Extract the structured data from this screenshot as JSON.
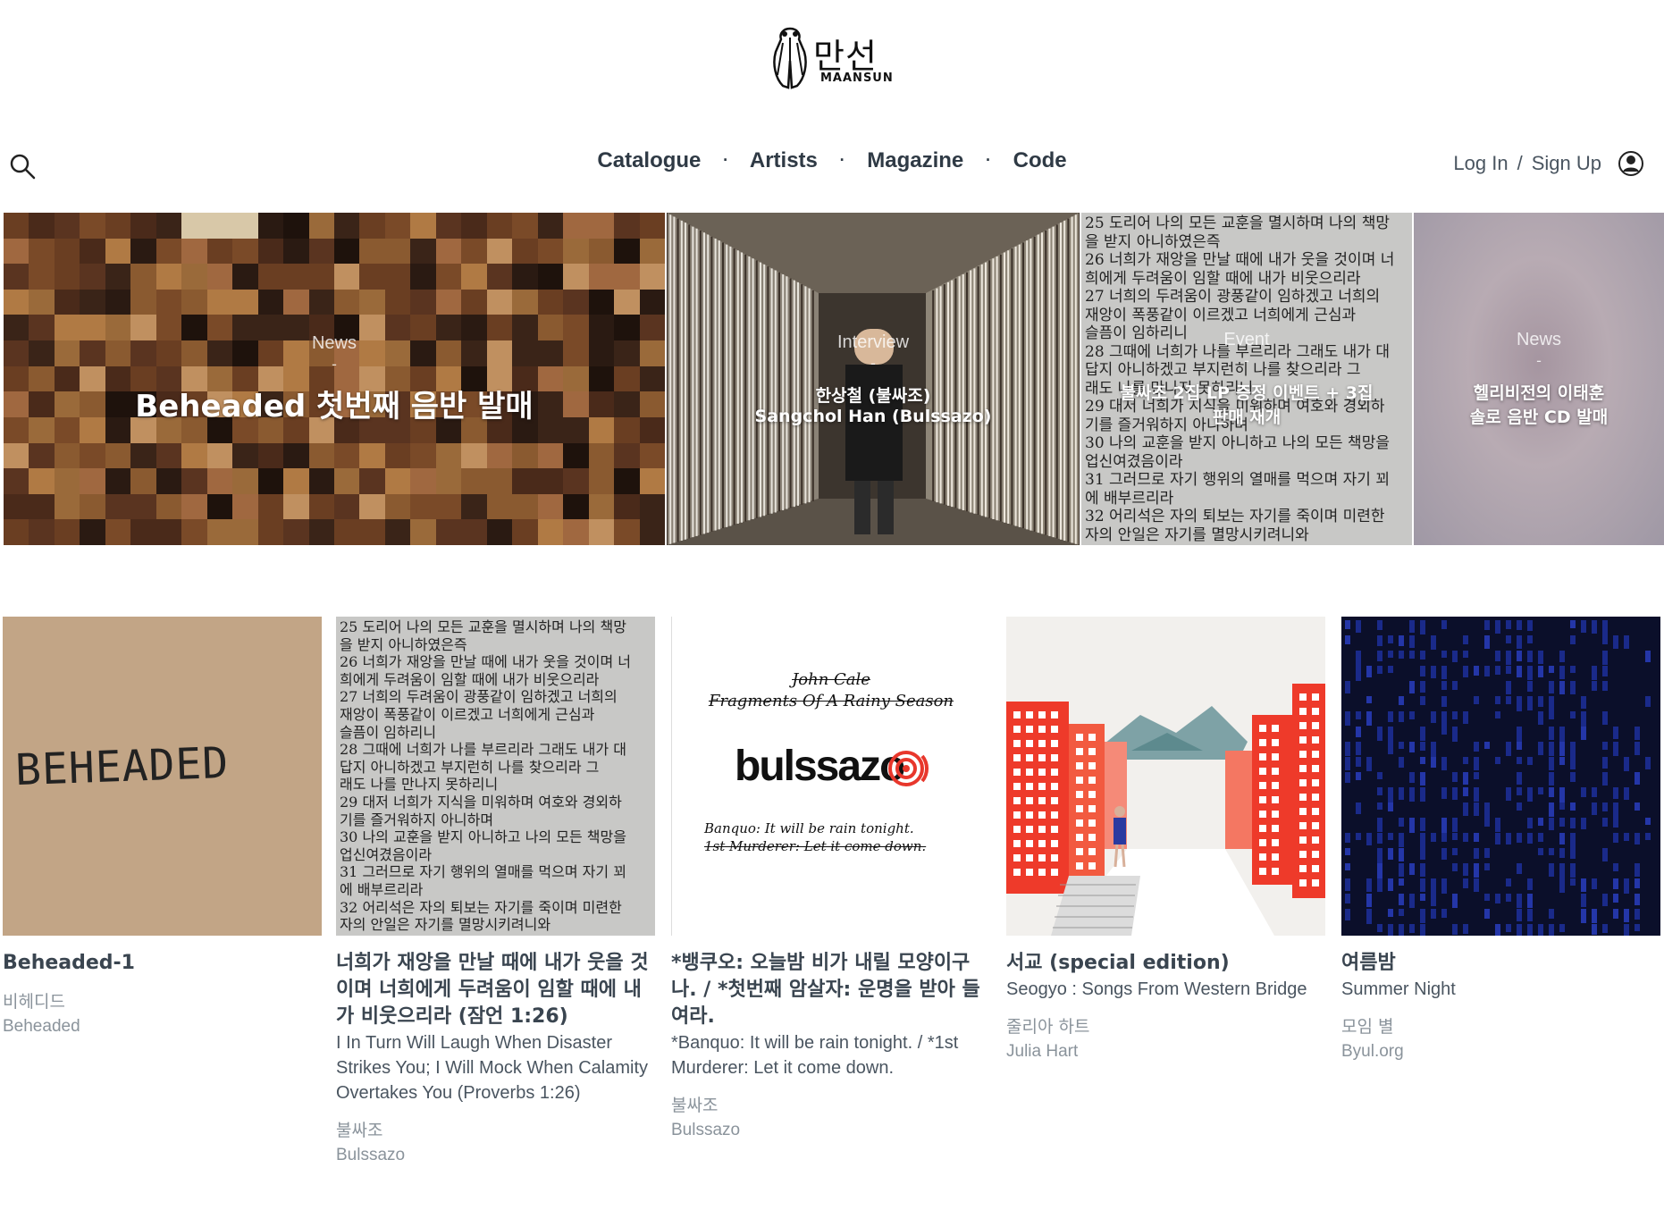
{
  "header": {
    "logo_text": "만선",
    "logo_sub": "MAANSUN"
  },
  "nav": {
    "items": [
      "Catalogue",
      "Artists",
      "Magazine",
      "Code"
    ],
    "separator": "·"
  },
  "auth": {
    "login": "Log In",
    "separator": "/",
    "signup": "Sign Up"
  },
  "hero": [
    {
      "category": "News",
      "dash": "-",
      "title": "Beheaded 첫번째 음반 발매"
    },
    {
      "category": "Interview",
      "dash": "-",
      "title_line1": "한상철 (불싸조)",
      "title_line2": "Sangchol Han (Bulssazo)"
    },
    {
      "category": "Event",
      "dash": "-",
      "title_line1": "불싸조 2집 LP 증정 이벤트 + 3집",
      "title_line2": "판매 재개"
    },
    {
      "category": "News",
      "dash": "-",
      "title_line1": "헬리비전의 이태훈",
      "title_line2": "솔로 음반 CD 발매"
    }
  ],
  "hero3_text": [
    "25 도리어 나의 모든 교훈을 멸시하며 나의 책망",
    "을 받지 아니하였은즉",
    "26 너희가 재앙을 만날 때에 내가 웃을 것이며 너",
    "희에게 두려움이 임할 때에 내가 비웃으리라",
    "27 너희의 두려움이 광풍같이 임하겠고 너희의",
    "재앙이 폭풍같이 이르겠고 너희에게 근심과",
    "슬픔이 임하리니",
    "28 그때에 너희가 나를 부르리라 그래도 내가 대",
    "답지 아니하겠고 부지런히 나를 찾으리라 그",
    "래도 나를 만나지 못하리니",
    "29 대저 너희가 지식을 미워하며 여호와 경외하",
    "기를 즐거워하지 아니하며",
    "30 나의 교훈을 받지 아니하고 나의 모든 책망을",
    "업신여겼음이라",
    "31 그러므로 자기 행위의 열매를 먹으며 자기 꾀",
    "에 배부르리라",
    "32 어리석은 자의 퇴보는 자기를 죽이며 미련한",
    "자의 안일은 자기를 멸망시키려니와"
  ],
  "cards": [
    {
      "cover_text": "BEHEADED",
      "title": "Beheaded-1",
      "subtitle": "",
      "artist_ko": "비헤디드",
      "artist_en": "Beheaded"
    },
    {
      "title": "너희가 재앙을 만날 때에 내가 웃을 것이며 너희에게 두려움이 임할 때에 내가 비웃으리라 (잠언 1:26)",
      "subtitle": "I In Turn Will Laugh When Disaster Strikes You; I Will Mock When Calamity Overtakes You (Proverbs 1:26)",
      "artist_ko": "불싸조",
      "artist_en": "Bulssazo"
    },
    {
      "cover_line1": "John Cale",
      "cover_line2": "Fragments Of A Rainy Season",
      "cover_brand": "bulssazo",
      "cover_quote1": "Banquo: It will be rain tonight.",
      "cover_quote2": "1st Murderer: Let it come down.",
      "title": "*뱅쿠오: 오늘밤 비가 내릴 모양이구나. / *첫번째 암살자: 운명을 받아 들여라.",
      "subtitle": "*Banquo: It will be rain tonight. / *1st Murderer: Let it come down.",
      "artist_ko": "불싸조",
      "artist_en": "Bulssazo"
    },
    {
      "title": "서교 (special edition)",
      "subtitle": "Seogyo : Songs From Western Bridge",
      "artist_ko": "줄리아 하트",
      "artist_en": "Julia Hart"
    },
    {
      "title": "여름밤",
      "subtitle": "Summer Night",
      "artist_ko": "모임 별",
      "artist_en": "Byul.org"
    }
  ],
  "colors": {
    "text_dark": "#2f3a45",
    "text_muted": "#8a939b",
    "accent_red": "#e8372c",
    "night_blue": "#1a2a8a"
  }
}
